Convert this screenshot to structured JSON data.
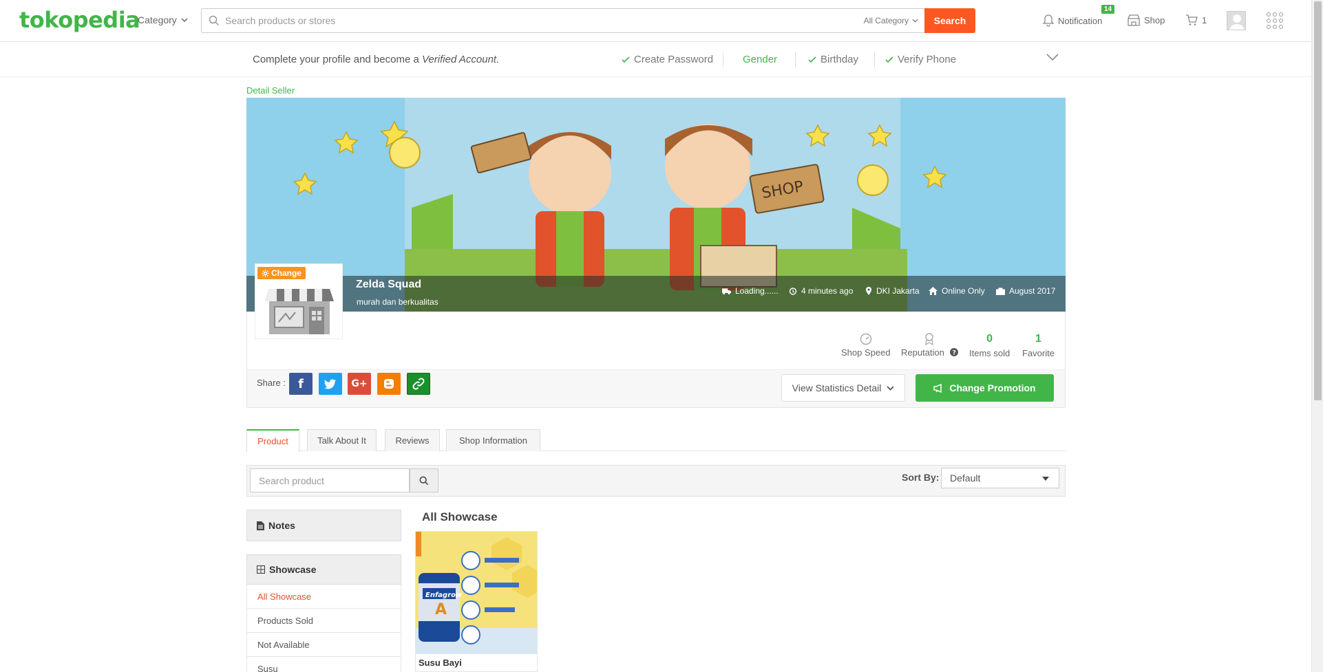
{
  "header": {
    "logo": "tokopedia",
    "category_label": "Category",
    "search_placeholder": "Search products or stores",
    "all_category": "All Category",
    "search_button": "Search",
    "notification_label": "Notification",
    "notification_count": "14",
    "shop_label": "Shop",
    "cart_count": "1"
  },
  "profile_bar": {
    "message_prefix": "Complete your profile and become a ",
    "message_emphasis": "Verified Account.",
    "steps": [
      "Create Password",
      "Gender",
      "Birthday",
      "Verify Phone"
    ]
  },
  "shop": {
    "breadcrumb": "Detail Seller",
    "name": "Zelda Squad",
    "tagline": "murah dan berkualitas",
    "change_label": "Change",
    "meta": {
      "loading": "Loading......",
      "last_online": "4 minutes ago",
      "location": "DKI Jakarta",
      "type": "Online Only",
      "since": "August 2017"
    },
    "stats": {
      "shop_speed": "Shop Speed",
      "reputation": "Reputation",
      "items_sold_value": "0",
      "items_sold_label": "Items sold",
      "favorite_value": "1",
      "favorite_label": "Favorite"
    },
    "share_label": "Share :",
    "view_stats_label": "View Statistics Detail",
    "promo_label": "Change Promotion"
  },
  "tabs": [
    "Product",
    "Talk About It",
    "Reviews",
    "Shop Information"
  ],
  "filter": {
    "search_placeholder": "Search product",
    "sort_label": "Sort By:",
    "sort_value": "Default"
  },
  "sidebar": {
    "notes_title": "Notes",
    "showcase_title": "Showcase",
    "items": [
      "All Showcase",
      "Products Sold",
      "Not Available",
      "Susu"
    ]
  },
  "main": {
    "title": "All Showcase",
    "products": [
      {
        "name": "Susu Bayi"
      }
    ]
  },
  "colors": {
    "brand_green": "#42b549",
    "search_orange": "#ff5722",
    "change_orange": "#f7941d",
    "active_red": "#e2532b"
  }
}
